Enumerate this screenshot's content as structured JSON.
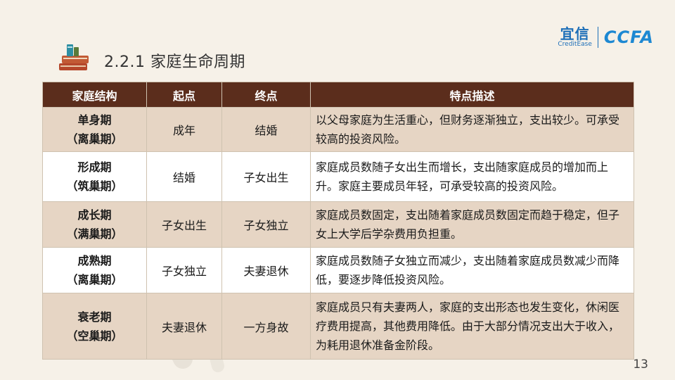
{
  "header": {
    "title": "2.2.1 家庭生命周期"
  },
  "logos": {
    "brand_cn": "宜信",
    "brand_en": "CreditEase",
    "partner": "CCFA"
  },
  "table": {
    "columns": [
      "家庭结构",
      "起点",
      "终点",
      "特点描述"
    ],
    "rows": [
      {
        "stage": "单身期",
        "sub": "（离巢期）",
        "start": "成年",
        "end": "结婚",
        "desc": "以父母家庭为生活重心，但财务逐渐独立，支出较少。可承受较高的投资风险。"
      },
      {
        "stage": "形成期",
        "sub": "（筑巢期）",
        "start": "结婚",
        "end": "子女出生",
        "desc": "家庭成员数随子女出生而增长，支出随家庭成员的增加而上升。家庭主要成员年轻，可承受较高的投资风险。"
      },
      {
        "stage": "成长期",
        "sub": "（满巢期）",
        "start": "子女出生",
        "end": "子女独立",
        "desc": "家庭成员数固定，支出随着家庭成员数固定而趋于稳定，但子女上大学后学杂费用负担重。"
      },
      {
        "stage": "成熟期",
        "sub": "（离巢期）",
        "start": "子女独立",
        "end": "夫妻退休",
        "desc": "家庭成员数随子女独立而减少，支出随着家庭成员数减少而降低，要逐步降低投资风险。"
      },
      {
        "stage": "衰老期",
        "sub": "（空巢期）",
        "start": "夫妻退休",
        "end": "一方身故",
        "desc": "家庭成员只有夫妻两人，家庭的支出形态也发生变化，休闲医疗费用提高，其他费用降低。由于大部分情况支出大于收入，为耗用退休准备金阶段。"
      }
    ]
  },
  "footer": {
    "page_number": "13"
  }
}
